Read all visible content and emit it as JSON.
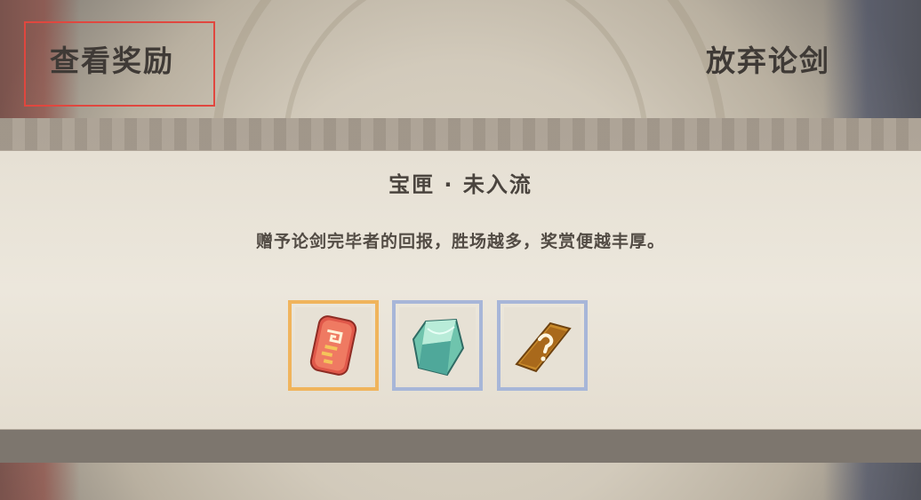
{
  "header": {
    "view_rewards_label": "查看奖励",
    "abandon_label": "放弃论剑"
  },
  "dialog": {
    "title": "宝匣 · 未入流",
    "description": "赠予论剑完毕者的回报，胜场越多，奖赏便越丰厚。"
  },
  "rewards": [
    {
      "icon": "red-token-icon",
      "frame_color": "#f0b45c"
    },
    {
      "icon": "jade-crystal-icon",
      "frame_color": "#a7b6d8"
    },
    {
      "icon": "mystery-card-icon",
      "frame_color": "#a7b6d8"
    }
  ],
  "colors": {
    "highlight": "#e0473f",
    "text_dark": "#3f3a36"
  }
}
